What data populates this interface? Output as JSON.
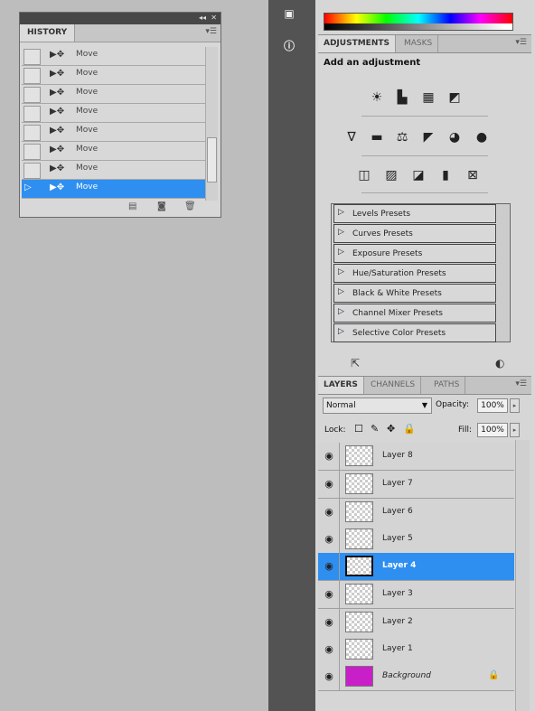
{
  "history": {
    "tab": "HISTORY",
    "items": [
      {
        "label": "Move",
        "selected": false
      },
      {
        "label": "Move",
        "selected": false
      },
      {
        "label": "Move",
        "selected": false
      },
      {
        "label": "Move",
        "selected": false
      },
      {
        "label": "Move",
        "selected": false
      },
      {
        "label": "Move",
        "selected": false
      },
      {
        "label": "Move",
        "selected": false
      },
      {
        "label": "Move",
        "selected": true
      }
    ]
  },
  "adjustments": {
    "tabs": [
      "ADJUSTMENTS",
      "MASKS"
    ],
    "heading": "Add an adjustment",
    "presets": [
      "Levels Presets",
      "Curves Presets",
      "Exposure Presets",
      "Hue/Saturation Presets",
      "Black & White Presets",
      "Channel Mixer Presets",
      "Selective Color Presets"
    ]
  },
  "layers_panel": {
    "tabs": [
      "LAYERS",
      "CHANNELS",
      "PATHS"
    ],
    "blend_mode": "Normal",
    "opacity_label": "Opacity:",
    "opacity": "100%",
    "lock_label": "Lock:",
    "fill_label": "Fill:",
    "fill": "100%",
    "layers": [
      {
        "name": "Layer 8",
        "selected": false
      },
      {
        "name": "Layer 7",
        "selected": false
      },
      {
        "name": "Layer 6",
        "selected": false
      },
      {
        "name": "Layer 5",
        "selected": false
      },
      {
        "name": "Layer 4",
        "selected": true
      },
      {
        "name": "Layer 3",
        "selected": false
      },
      {
        "name": "Layer 2",
        "selected": false
      },
      {
        "name": "Layer 1",
        "selected": false
      },
      {
        "name": "Background",
        "selected": false,
        "background": true
      }
    ]
  },
  "colors": {
    "selection": "#2e8ff0",
    "background_swatch": "#c81fc8",
    "dock": "#535353"
  }
}
